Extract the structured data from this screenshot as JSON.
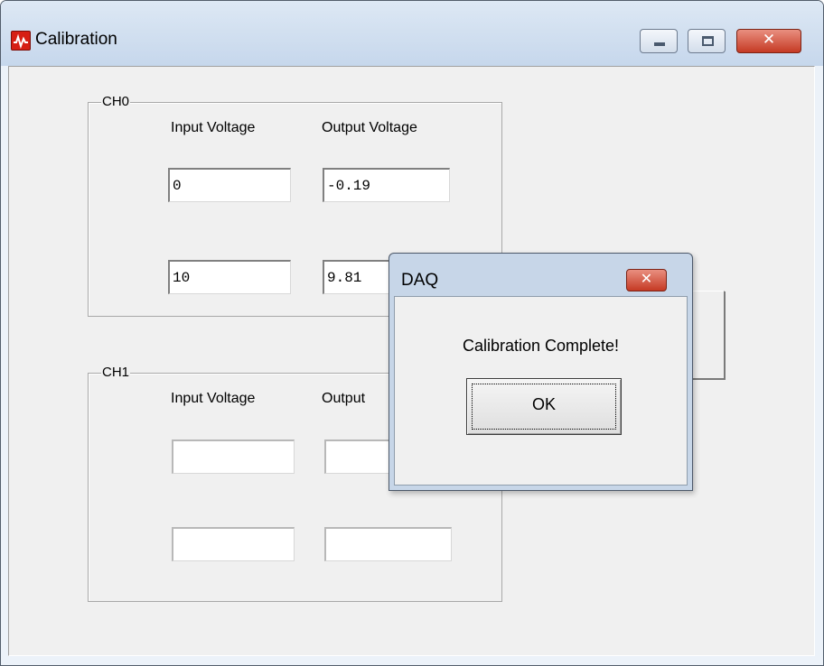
{
  "window": {
    "title": "Calibration",
    "app_icon": "waveform-icon"
  },
  "ch0": {
    "label": "CH0",
    "input_header": "Input Voltage",
    "output_header": "Output Voltage",
    "rows": [
      {
        "input": "0",
        "output": "-0.19"
      },
      {
        "input": "10",
        "output": "9.81"
      }
    ]
  },
  "ch1": {
    "label": "CH1",
    "input_header": "Input Voltage",
    "output_header": "Output",
    "rows": [
      {
        "input": "",
        "output": ""
      },
      {
        "input": "",
        "output": ""
      }
    ]
  },
  "dialog": {
    "title": "DAQ",
    "message": "Calibration Complete!",
    "ok_label": "OK"
  },
  "colors": {
    "close_button": "#c53a24",
    "titlebar": "#c6d7ec"
  }
}
